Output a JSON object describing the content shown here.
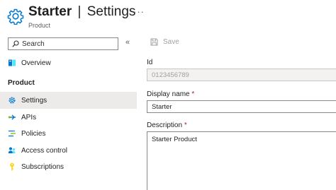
{
  "header": {
    "title_main": "Starter",
    "title_separator": "|",
    "title_sub": "Settings",
    "subtitle": "Product",
    "more_label": "···"
  },
  "sidebar": {
    "search_placeholder": "Search",
    "collapse_label": "«",
    "overview": "Overview",
    "section_product": "Product",
    "items": [
      {
        "label": "Settings",
        "icon": "gear-icon"
      },
      {
        "label": "APIs",
        "icon": "api-icon"
      },
      {
        "label": "Policies",
        "icon": "policies-icon"
      },
      {
        "label": "Access control",
        "icon": "access-control-icon"
      },
      {
        "label": "Subscriptions",
        "icon": "key-icon"
      }
    ],
    "active_item": "Settings"
  },
  "toolbar": {
    "save_label": "Save"
  },
  "form": {
    "id_label": "Id",
    "id_value": "0123456789",
    "display_name_label": "Display name",
    "display_name_required": "*",
    "display_name_value": "Starter",
    "description_label": "Description",
    "description_required": "*",
    "description_value": "Starter Product"
  },
  "colors": {
    "accent": "#0078d4",
    "active_bg": "#edebe9",
    "required": "#a4262c",
    "disabled_bg": "#f3f2f1"
  }
}
